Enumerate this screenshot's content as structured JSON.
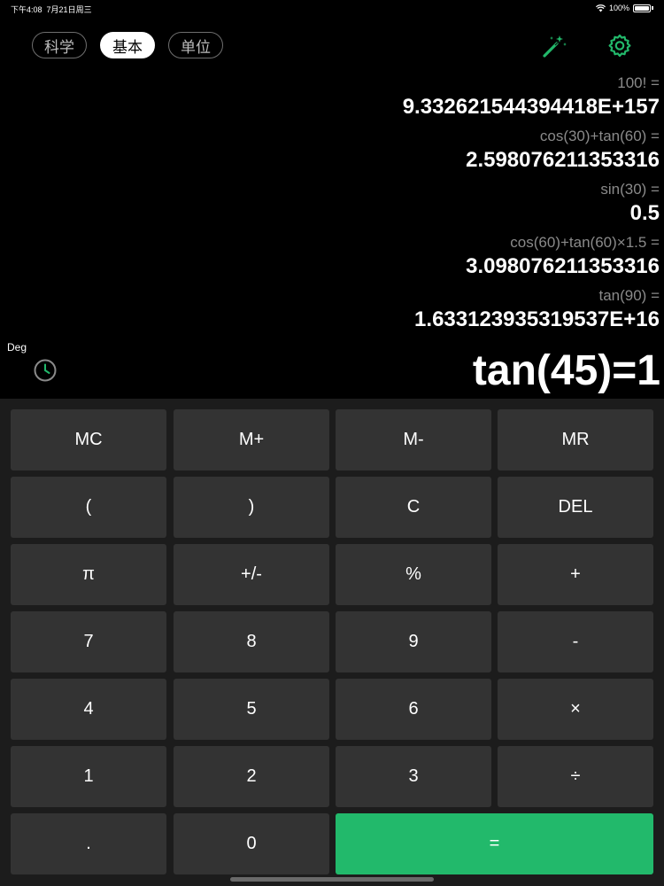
{
  "status_bar": {
    "time": "下午4:08",
    "date": "7月21日周三",
    "battery": "100%"
  },
  "mode_tabs": [
    {
      "label": "科学",
      "active": false
    },
    {
      "label": "基本",
      "active": true
    },
    {
      "label": "单位",
      "active": false
    }
  ],
  "colors": {
    "accent_green": "#22b96b",
    "key_bg": "#333333",
    "keypad_bg": "#1c1c1c"
  },
  "history": [
    {
      "expr": "100! =",
      "result": "9.332621544394418E+157"
    },
    {
      "expr": "cos(30)+tan(60) =",
      "result": "2.598076211353316"
    },
    {
      "expr": "sin(30) =",
      "result": "0.5"
    },
    {
      "expr": "cos(60)+tan(60)×1.5 =",
      "result": "3.098076211353316"
    },
    {
      "expr": "tan(90) =",
      "result": "1.633123935319537E+16"
    }
  ],
  "angle_mode": "Deg",
  "current_display": "tan(45)=1",
  "keys": {
    "mc": "MC",
    "m_plus": "M+",
    "m_minus": "M-",
    "mr": "MR",
    "paren_open": "(",
    "paren_close": ")",
    "clear": "C",
    "del": "DEL",
    "pi": "π",
    "plus_minus": "+/-",
    "percent": "%",
    "plus": "+",
    "seven": "7",
    "eight": "8",
    "nine": "9",
    "minus": "-",
    "four": "4",
    "five": "5",
    "six": "6",
    "multiply": "×",
    "one": "1",
    "two": "2",
    "three": "3",
    "divide": "÷",
    "dot": ".",
    "zero": "0",
    "equals": "="
  },
  "icons": {
    "wand": "magic-wand-icon",
    "gear": "gear-icon",
    "history": "clock-icon"
  }
}
